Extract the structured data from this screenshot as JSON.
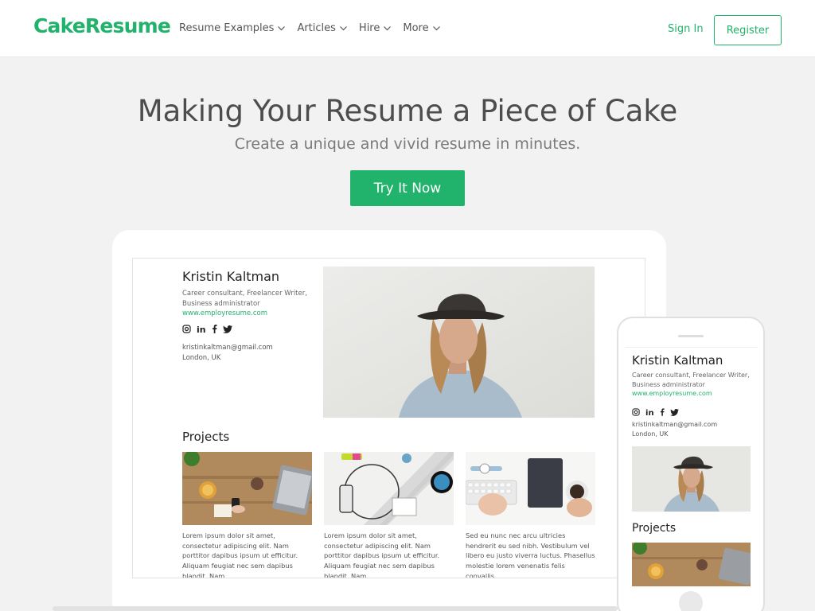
{
  "header": {
    "logo": "CakeResume",
    "nav": [
      {
        "label": "Resume Examples"
      },
      {
        "label": "Articles"
      },
      {
        "label": "Hire"
      },
      {
        "label": "More"
      }
    ],
    "signin": "Sign In",
    "register": "Register"
  },
  "hero": {
    "title": "Making Your Resume a Piece of Cake",
    "subtitle": "Create a unique and vivid resume in minutes.",
    "cta": "Try It Now"
  },
  "resume": {
    "name": "Kristin Kaltman",
    "role": "Career consultant, Freelancer Writer, Business administrator",
    "website": "www.employresume.com",
    "email": "kristinkaltman@gmail.com",
    "location": "London, UK",
    "projects_title": "Projects",
    "projects": [
      {
        "text": "Lorem ipsum dolor sit amet, consectetur adipiscing elit. Nam porttitor dapibus ipsum ut efficitur. Aliquam feugiat nec sem dapibus blandit. Nam"
      },
      {
        "text": "Lorem ipsum dolor sit amet, consectetur adipiscing elit. Nam porttitor dapibus ipsum ut efficitur. Aliquam feugiat nec sem dapibus blandit. Nam"
      },
      {
        "text": "Sed eu nunc nec arcu ultricies hendrerit eu sed nibh. Vestibulum vel libero eu justo viverra luctus. Phasellus molestie lorem venenatis felis convallis."
      }
    ]
  },
  "colors": {
    "brand": "#21b26b",
    "background": "#f2f2f3"
  },
  "icons": [
    "chevron-down-icon",
    "instagram-icon",
    "linkedin-icon",
    "facebook-icon",
    "twitter-icon"
  ]
}
